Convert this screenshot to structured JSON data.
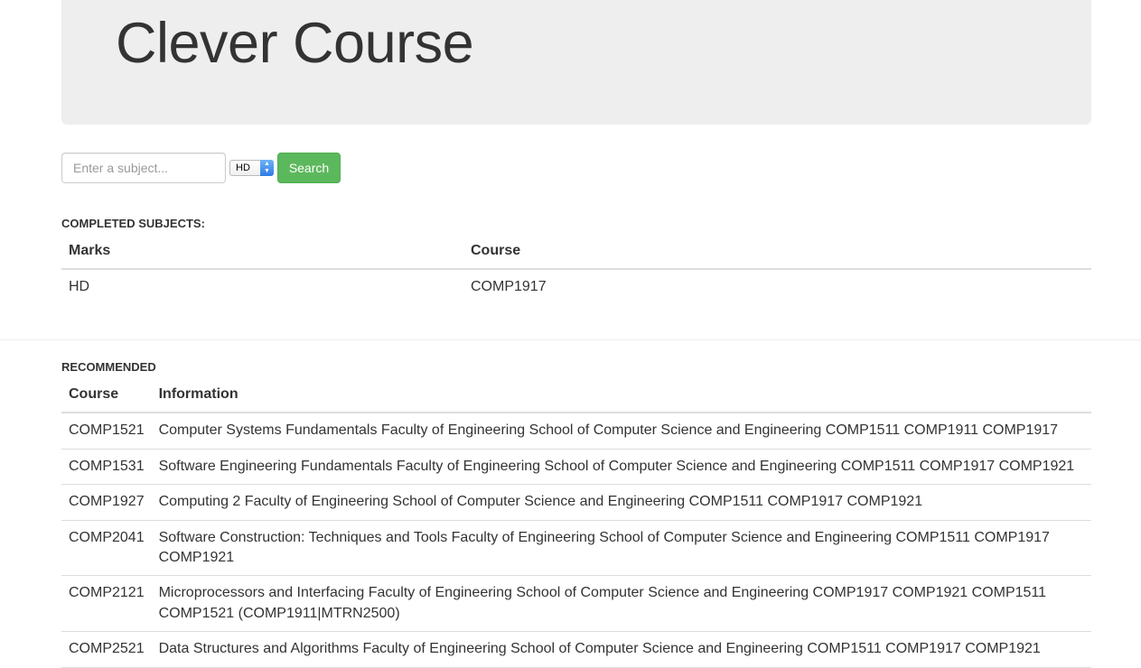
{
  "header": {
    "title": "Clever Course"
  },
  "search": {
    "placeholder": "Enter a subject...",
    "grade_selected": "HD",
    "button_label": "Search"
  },
  "completed": {
    "heading": "COMPLETED SUBJECTS:",
    "columns": [
      "Marks",
      "Course"
    ],
    "rows": [
      {
        "marks": "HD",
        "course": "COMP1917"
      }
    ]
  },
  "recommended": {
    "heading": "RECOMMENDED",
    "columns": [
      "Course",
      "Information"
    ],
    "rows": [
      {
        "course": "COMP1521",
        "info": "Computer Systems Fundamentals Faculty of Engineering School of Computer Science and Engineering COMP1511 COMP1911 COMP1917"
      },
      {
        "course": "COMP1531",
        "info": "Software Engineering Fundamentals Faculty of Engineering School of Computer Science and Engineering COMP1511 COMP1917 COMP1921"
      },
      {
        "course": "COMP1927",
        "info": "Computing 2 Faculty of Engineering School of Computer Science and Engineering COMP1511 COMP1917 COMP1921"
      },
      {
        "course": "COMP2041",
        "info": "Software Construction: Techniques and Tools Faculty of Engineering School of Computer Science and Engineering COMP1511 COMP1917 COMP1921"
      },
      {
        "course": "COMP2121",
        "info": "Microprocessors and Interfacing Faculty of Engineering School of Computer Science and Engineering COMP1917 COMP1921 COMP1511 COMP1521 (COMP1911|MTRN2500)"
      },
      {
        "course": "COMP2521",
        "info": "Data Structures and Algorithms Faculty of Engineering School of Computer Science and Engineering COMP1511 COMP1917 COMP1921"
      }
    ]
  },
  "colors": {
    "jumbotron_bg": "#eeeeee",
    "button_success": "#5cb85c",
    "text": "#333333"
  }
}
